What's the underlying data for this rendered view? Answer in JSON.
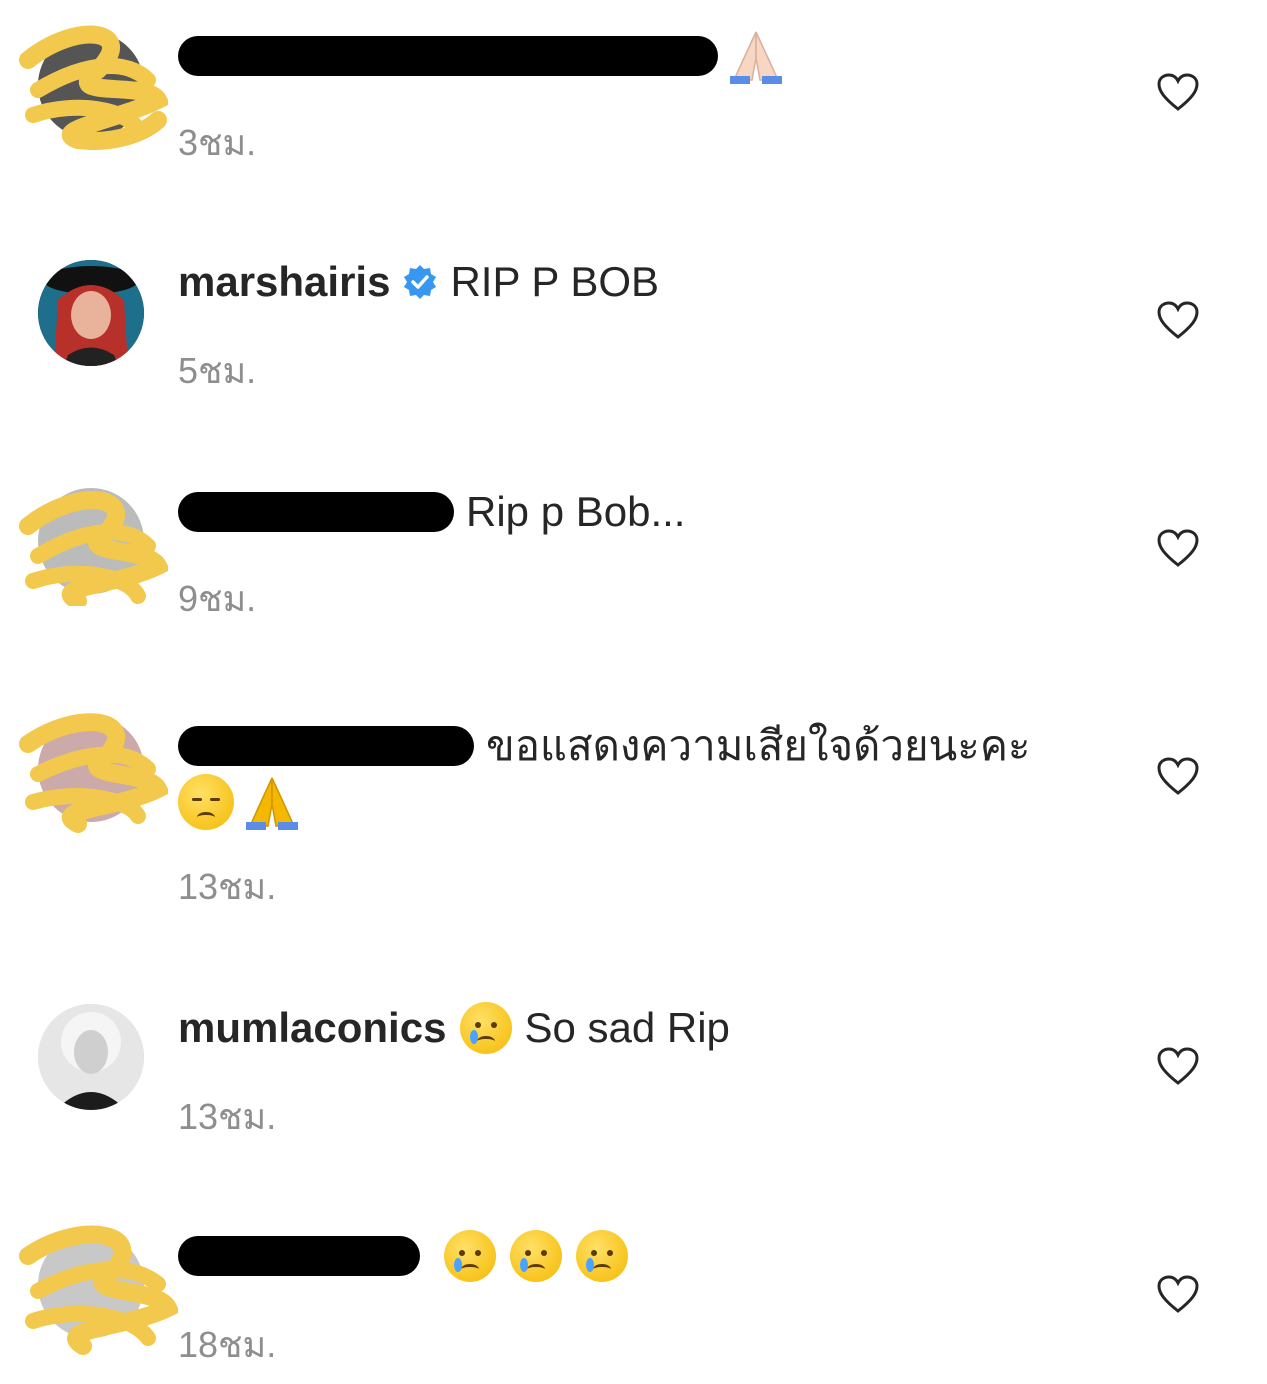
{
  "comments": [
    {
      "username_visible": "",
      "text_tail": "",
      "time": "3ชม.",
      "emoji": [
        "folded-hands-light"
      ],
      "like_icon": "heart-outline-icon"
    },
    {
      "username_visible": "marshairis",
      "verified": true,
      "text": "RIP P BOB",
      "time": "5ชม.",
      "like_icon": "heart-outline-icon"
    },
    {
      "username_visible": "",
      "text": "Rip p Bob...",
      "time": "9ชม.",
      "like_icon": "heart-outline-icon"
    },
    {
      "username_visible": "",
      "text": "ขอแสดงความเสียใจด้วยนะคะ",
      "emoji": [
        "pensive-face",
        "folded-hands"
      ],
      "time": "13ชม.",
      "like_icon": "heart-outline-icon"
    },
    {
      "username_visible": "mumlaconics",
      "text": "So sad Rip",
      "emoji": [
        "crying-face"
      ],
      "time": "13ชม.",
      "like_icon": "heart-outline-icon"
    },
    {
      "username_visible": "",
      "text": "",
      "emoji": [
        "crying-face",
        "crying-face",
        "crying-face"
      ],
      "time": "18ชม.",
      "like_icon": "heart-outline-icon"
    }
  ],
  "colors": {
    "text": "#262626",
    "secondary": "#8e8e8e",
    "verified": "#3897f0",
    "scribble": "#f2c94c"
  }
}
